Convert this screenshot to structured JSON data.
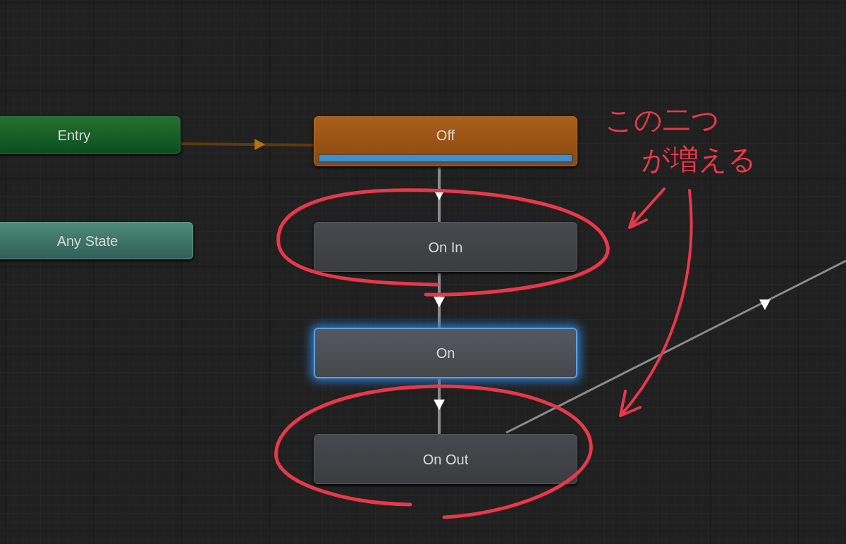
{
  "nodes": [
    {
      "kind": "entry",
      "label": "Entry",
      "selected": false
    },
    {
      "kind": "any_state",
      "label": "Any State",
      "selected": false
    },
    {
      "kind": "default",
      "label": "Off",
      "selected": false,
      "level": 1
    },
    {
      "kind": "state",
      "label": "On In",
      "selected": false
    },
    {
      "kind": "state",
      "label": "On",
      "selected": true
    },
    {
      "kind": "state",
      "label": "On Out",
      "selected": false
    }
  ],
  "annotation": {
    "lines": [
      "この二つ",
      "が増える"
    ]
  }
}
